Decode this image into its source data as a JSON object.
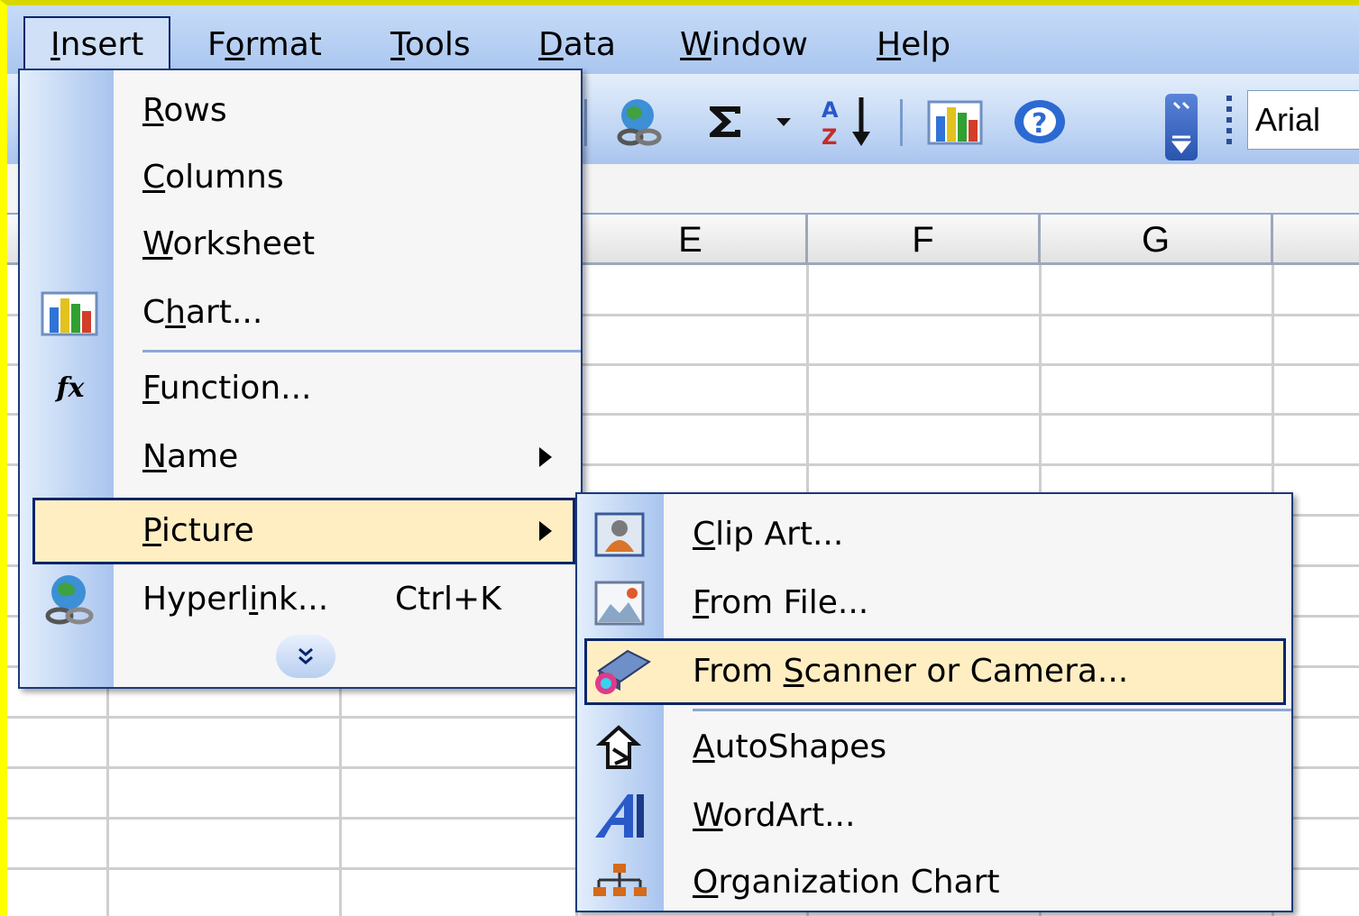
{
  "menubar": {
    "items": [
      {
        "label": "Insert",
        "mnemonic": "I",
        "rest": "nsert"
      },
      {
        "label": "Format",
        "pre": "F",
        "mnemonic": "o",
        "rest": "rmat"
      },
      {
        "label": "Tools",
        "mnemonic": "T",
        "rest": "ools"
      },
      {
        "label": "Data",
        "mnemonic": "D",
        "rest": "ata"
      },
      {
        "label": "Window",
        "mnemonic": "W",
        "rest": "indow"
      },
      {
        "label": "Help",
        "mnemonic": "H",
        "rest": "elp"
      }
    ]
  },
  "toolbar": {
    "font_name": "Arial",
    "icons": [
      "insert-hyperlink-icon",
      "autosum-icon",
      "dropdown-arrow-icon",
      "sort-ascending-icon",
      "chart-wizard-icon",
      "help-icon",
      "toolbar-options-icon"
    ]
  },
  "sheet": {
    "columns": [
      "E",
      "F",
      "G"
    ]
  },
  "insert_menu": {
    "items": [
      {
        "mnemonic": "R",
        "rest": "ows",
        "icon": ""
      },
      {
        "mnemonic": "C",
        "rest": "olumns",
        "icon": ""
      },
      {
        "mnemonic": "W",
        "rest": "orksheet",
        "icon": ""
      },
      {
        "pre": "C",
        "mnemonic": "h",
        "rest": "art...",
        "icon": "chart-icon"
      },
      {
        "mnemonic": "F",
        "rest": "unction...",
        "icon": "function-icon"
      },
      {
        "mnemonic": "N",
        "rest": "ame",
        "icon": "",
        "submenu": true
      },
      {
        "mnemonic": "P",
        "rest": "icture",
        "icon": "",
        "submenu": true,
        "highlighted": true
      },
      {
        "pre": "Hyperl",
        "mnemonic": "i",
        "rest": "nk...",
        "icon": "hyperlink-icon",
        "shortcut": "Ctrl+K"
      }
    ],
    "expand_icon": "expand-chevron-icon"
  },
  "picture_submenu": {
    "items": [
      {
        "mnemonic": "C",
        "rest": "lip Art...",
        "icon": "clip-art-icon"
      },
      {
        "mnemonic": "F",
        "rest": "rom File...",
        "icon": "from-file-icon"
      },
      {
        "pre": "From ",
        "mnemonic": "S",
        "rest": "canner or Camera...",
        "icon": "scanner-icon",
        "highlighted": true
      },
      {
        "mnemonic": "A",
        "rest": "utoShapes",
        "icon": "autoshapes-icon"
      },
      {
        "mnemonic": "W",
        "rest": "ordArt...",
        "icon": "wordart-icon"
      },
      {
        "mnemonic": "O",
        "rest": "rganization Chart",
        "icon": "org-chart-icon"
      }
    ]
  },
  "colors": {
    "highlight_bg": "#ffeec2",
    "highlight_border": "#0a246a",
    "frame": "#ffff00"
  }
}
